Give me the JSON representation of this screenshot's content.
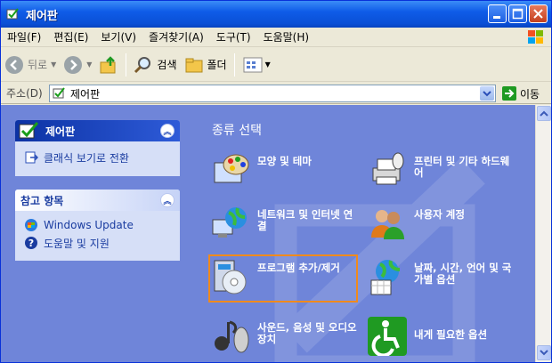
{
  "window": {
    "title": "제어판"
  },
  "menu": [
    "파일(F)",
    "편집(E)",
    "보기(V)",
    "즐겨찾기(A)",
    "도구(T)",
    "도움말(H)"
  ],
  "toolbar": {
    "back": "뒤로",
    "search": "검색",
    "folders": "폴더"
  },
  "address": {
    "label": "주소(D)",
    "value": "제어판",
    "go": "이동"
  },
  "sidebar": {
    "panel1": {
      "title": "제어판",
      "link": "클래식 보기로 전환"
    },
    "panel2": {
      "title": "참고 항목",
      "links": [
        "Windows Update",
        "도움말 및 지원"
      ]
    }
  },
  "main": {
    "heading": "종류 선택",
    "categories": [
      {
        "label": "모양 및 테마",
        "icon": "appearance-themes-icon"
      },
      {
        "label": "프린터 및 기타 하드웨어",
        "icon": "printer-hardware-icon"
      },
      {
        "label": "네트워크 및 인터넷 연결",
        "icon": "network-internet-icon"
      },
      {
        "label": "사용자 계정",
        "icon": "user-accounts-icon"
      },
      {
        "label": "프로그램 추가/제거",
        "icon": "add-remove-programs-icon"
      },
      {
        "label": "날짜, 시간, 언어 및 국가별 옵션",
        "icon": "date-time-language-icon"
      },
      {
        "label": "사운드, 음성 및 오디오 장치",
        "icon": "sounds-audio-icon"
      },
      {
        "label": "내게 필요한 옵션",
        "icon": "accessibility-icon"
      }
    ]
  },
  "colors": {
    "title_bar": "#0a4fd6",
    "content_bg": "#6f85d9",
    "highlight": "#f08a1d"
  }
}
